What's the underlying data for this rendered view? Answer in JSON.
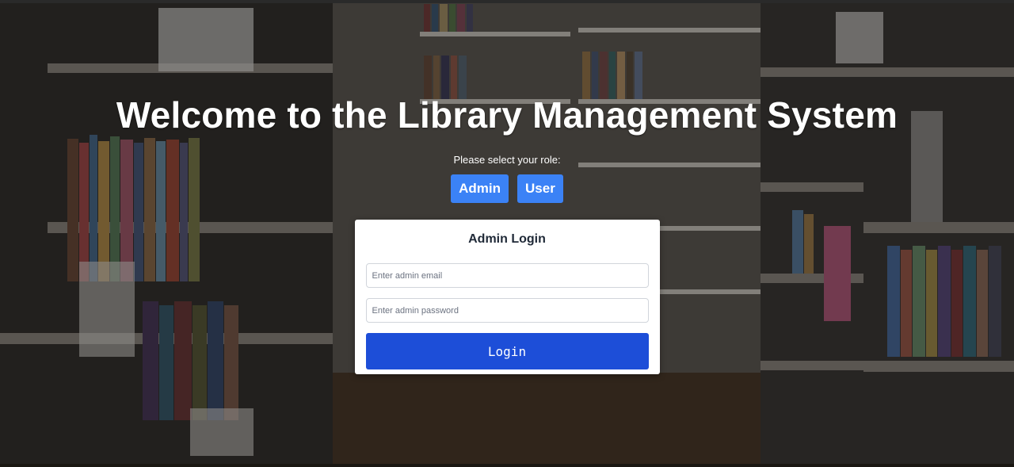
{
  "page": {
    "title": "Welcome to the Library Management System",
    "role_prompt": "Please select your role:"
  },
  "roles": {
    "admin_label": "Admin",
    "user_label": "User"
  },
  "login_form": {
    "title": "Admin Login",
    "email_placeholder": "Enter admin email",
    "password_placeholder": "Enter admin password",
    "submit_label": "Login"
  },
  "colors": {
    "role_button": "#3b82f6",
    "login_button": "#1d4ed8",
    "card_background": "#ffffff",
    "heading_text": "#ffffff"
  }
}
